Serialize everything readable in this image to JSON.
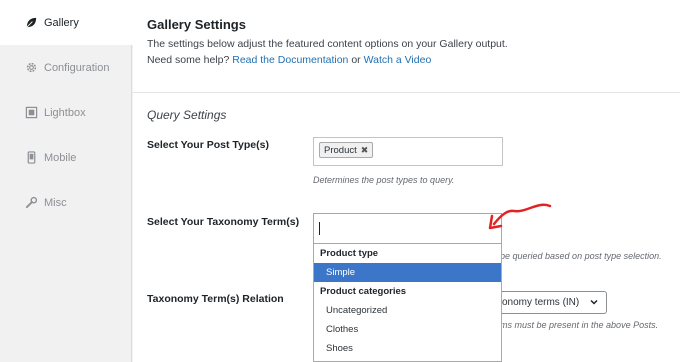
{
  "sidebar": {
    "items": [
      {
        "label": "Gallery",
        "icon": "leaf-icon"
      },
      {
        "label": "Configuration",
        "icon": "gear-icon"
      },
      {
        "label": "Lightbox",
        "icon": "lightbox-icon"
      },
      {
        "label": "Mobile",
        "icon": "mobile-icon"
      },
      {
        "label": "Misc",
        "icon": "wrench-icon"
      }
    ]
  },
  "main": {
    "title": "Gallery Settings",
    "description": "The settings below adjust the featured content options on your Gallery output.",
    "help_prefix": "Need some help?",
    "docs_link": "Read the Documentation",
    "or_text": "or",
    "video_link": "Watch a Video",
    "section_title": "Query Settings"
  },
  "post_type": {
    "label": "Select Your Post Type(s)",
    "chip": "Product",
    "help": "Determines the post types to query."
  },
  "taxonomy": {
    "label": "Select Your Taxonomy Term(s)",
    "help_partial": "be queried based on post type selection.",
    "dropdown": {
      "group1": "Product type",
      "option1": "Simple",
      "group2": "Product categories",
      "option2": "Uncategorized",
      "option3": "Clothes",
      "option4": "Shoes"
    }
  },
  "relation": {
    "label": "Taxonomy Term(s) Relation",
    "select_value_partial": "onomy terms (IN)",
    "help_partial": "ms must be present in the above Posts."
  },
  "colors": {
    "accent": "#2271b1",
    "highlight": "#3c76c9",
    "arrow": "#e02424"
  }
}
